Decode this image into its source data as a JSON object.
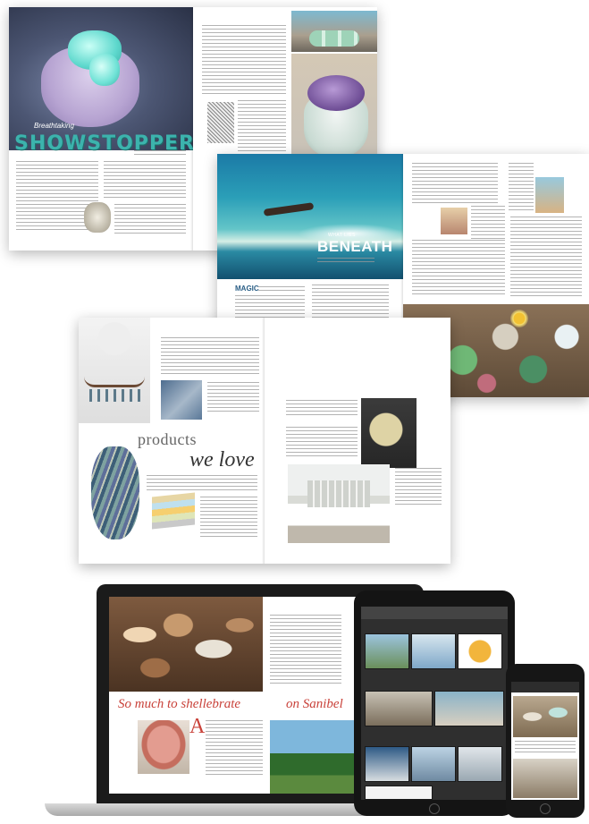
{
  "spread1": {
    "subtitle": "Breathtaking",
    "headline": "SHOWSTOPPERS"
  },
  "spread2": {
    "kicker": "WHAT LIES",
    "title": "BENEATH",
    "lead_word": "MAGIC"
  },
  "spread3": {
    "heading_products": "products",
    "heading_love": "we love"
  },
  "laptop_screen": {
    "headline_left": "So much to shellebrate",
    "headline_right": "on Sanibel",
    "dropcap": "A"
  },
  "colors": {
    "teal_headline": "#3cb3ad",
    "red_headline": "#c9423a",
    "navy_accent": "#2a5e86"
  }
}
